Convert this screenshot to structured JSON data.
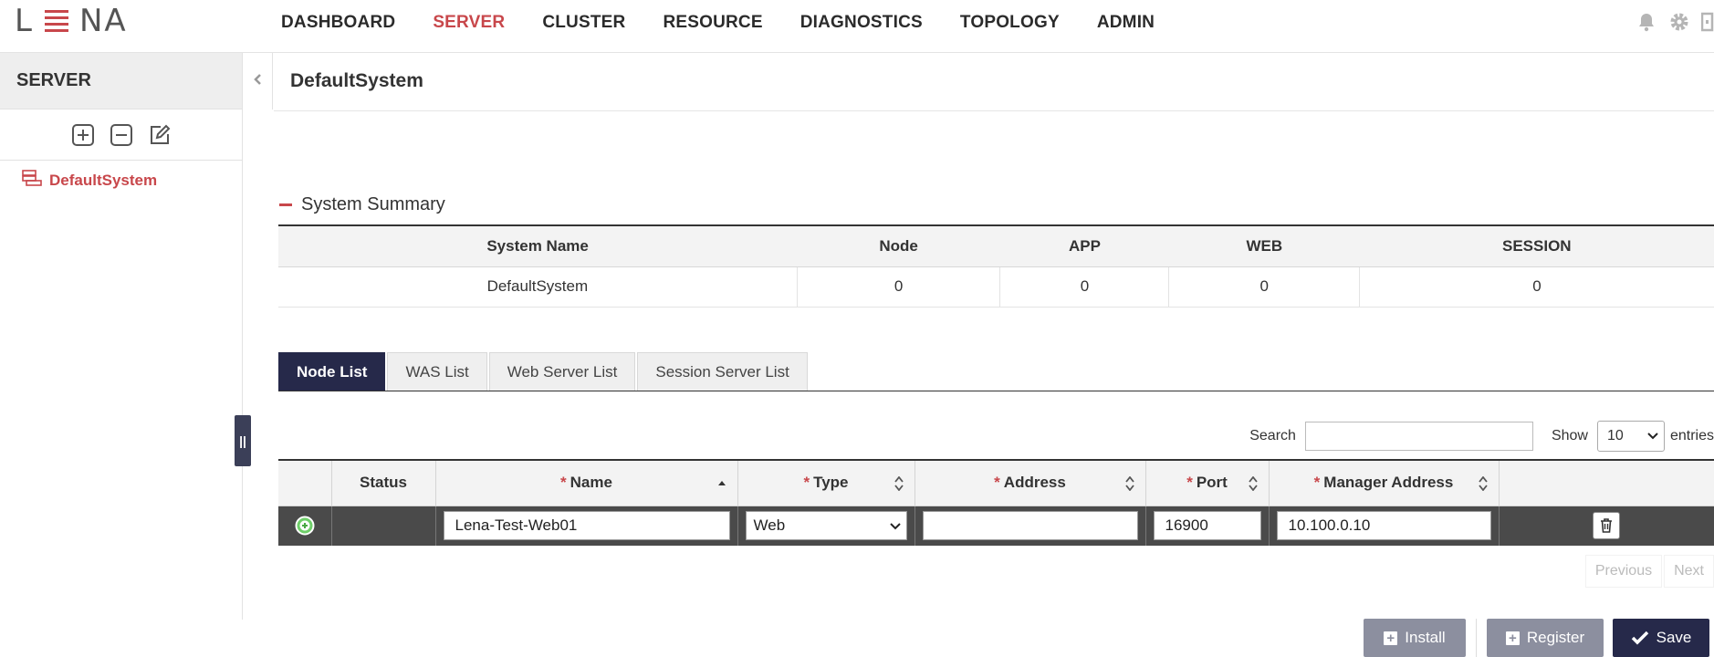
{
  "header": {
    "logo_left": "L",
    "logo_right": "NA",
    "nav": [
      {
        "label": "DASHBOARD",
        "active": false
      },
      {
        "label": "SERVER",
        "active": true
      },
      {
        "label": "CLUSTER",
        "active": false
      },
      {
        "label": "RESOURCE",
        "active": false
      },
      {
        "label": "DIAGNOSTICS",
        "active": false
      },
      {
        "label": "TOPOLOGY",
        "active": false
      },
      {
        "label": "ADMIN",
        "active": false
      }
    ],
    "icons": [
      "bell-icon",
      "gear-icon",
      "logout-icon"
    ]
  },
  "sidebar": {
    "title": "SERVER",
    "tools": [
      "add-icon",
      "remove-icon",
      "edit-icon"
    ],
    "tree": [
      {
        "label": "DefaultSystem",
        "icon": "system-icon"
      }
    ]
  },
  "main": {
    "title": "DefaultSystem",
    "summary": {
      "heading": "System Summary",
      "columns": [
        "System Name",
        "Node",
        "APP",
        "WEB",
        "SESSION"
      ],
      "row": [
        "DefaultSystem",
        "0",
        "0",
        "0",
        "0"
      ]
    },
    "tabs": [
      {
        "label": "Node List",
        "active": true
      },
      {
        "label": "WAS List",
        "active": false
      },
      {
        "label": "Web Server List",
        "active": false
      },
      {
        "label": "Session Server List",
        "active": false
      }
    ],
    "table_controls": {
      "search_label": "Search",
      "search_value": "",
      "show_label": "Show",
      "show_value": "10",
      "entries_label": "entries"
    },
    "grid": {
      "columns": [
        {
          "label": "",
          "required": false
        },
        {
          "label": "Status",
          "required": false
        },
        {
          "label": "Name",
          "required": true,
          "sort": "asc"
        },
        {
          "label": "Type",
          "required": true,
          "sort": "both"
        },
        {
          "label": "Address",
          "required": true,
          "sort": "both"
        },
        {
          "label": "Port",
          "required": true,
          "sort": "both"
        },
        {
          "label": "Manager Address",
          "required": true,
          "sort": "both"
        },
        {
          "label": "",
          "required": false
        }
      ],
      "required_mark": "*",
      "row": {
        "status": "",
        "name": "Lena-Test-Web01",
        "type": "Web",
        "address": "",
        "port": "16900",
        "manager_address": "10.100.0.10"
      }
    },
    "pager": {
      "previous": "Previous",
      "next": "Next"
    },
    "buttons": {
      "install": "Install",
      "register": "Register",
      "save": "Save"
    }
  },
  "colors": {
    "accent": "#c8474b",
    "navy": "#26294a",
    "row_bg": "#4a4a4a",
    "button_gray": "#8c8f9f"
  }
}
